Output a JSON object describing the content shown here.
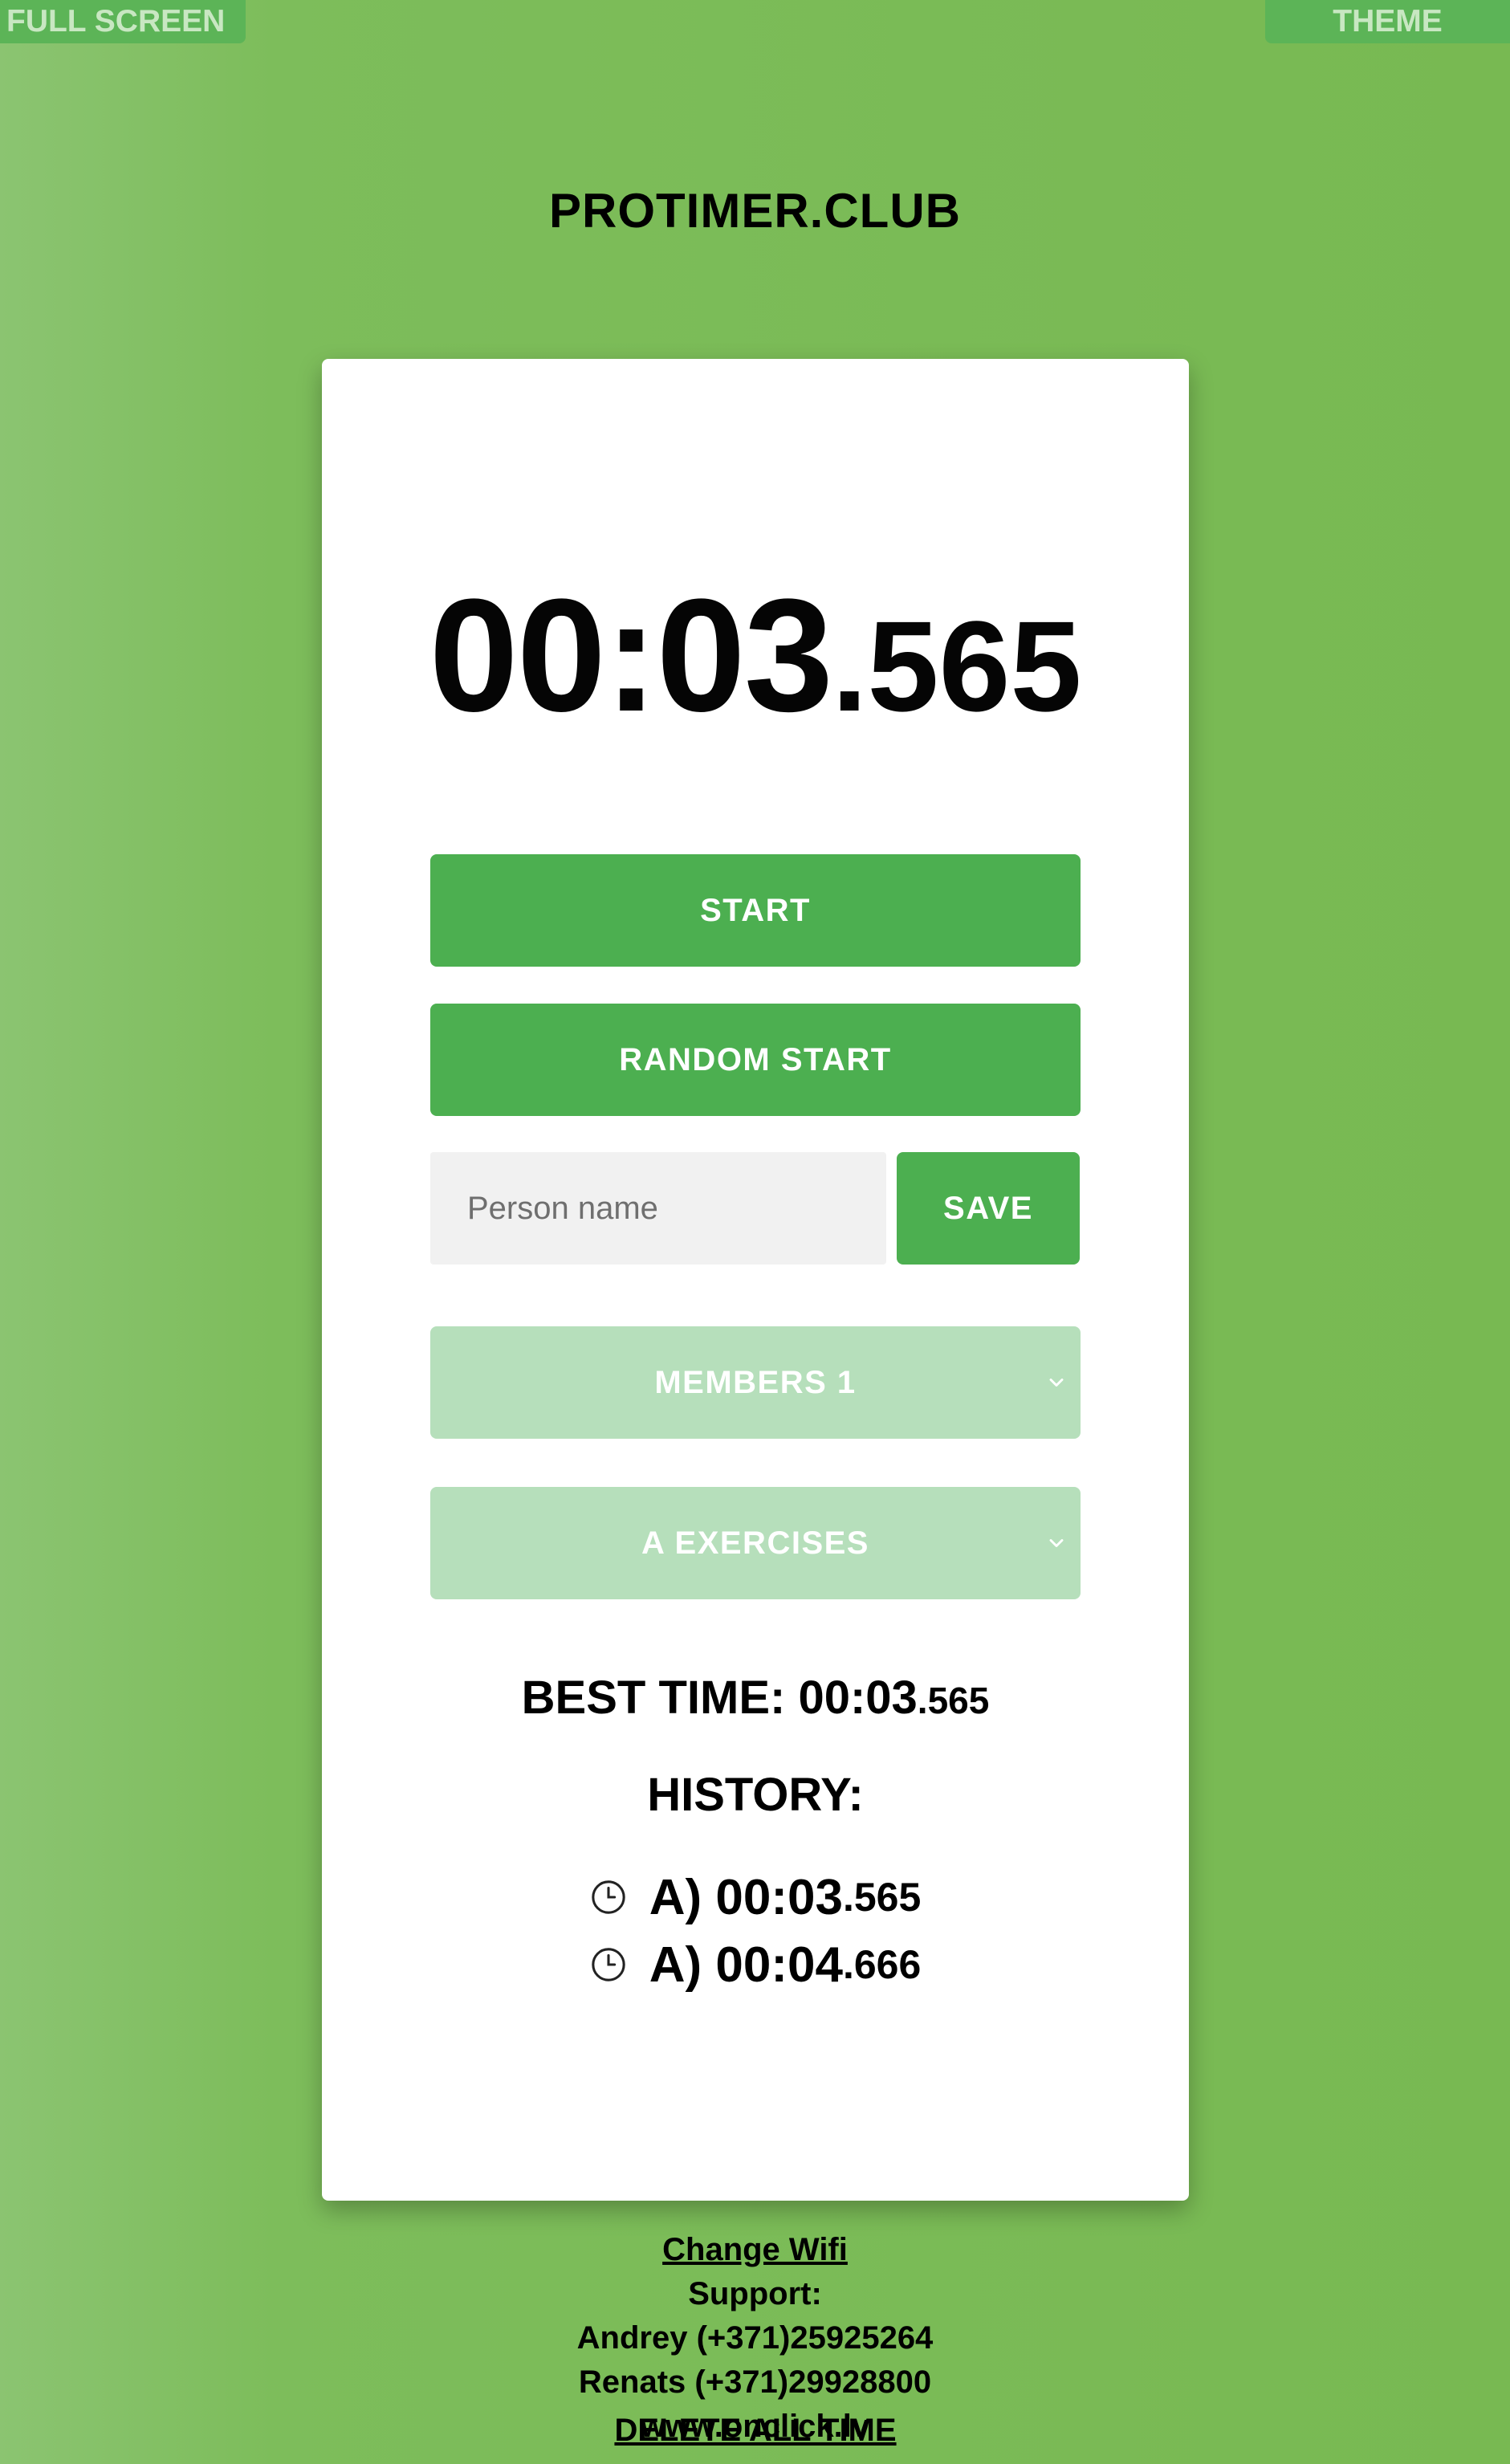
{
  "topbar": {
    "fullscreen_label": "FULL SCREEN",
    "theme_label": "THEME"
  },
  "site_title": "PROTIMER.CLUB",
  "timer": {
    "main": "00:03",
    "ms": ".565"
  },
  "buttons": {
    "start_label": "START",
    "random_start_label": "RANDOM START",
    "save_label": "SAVE"
  },
  "person_input": {
    "value": "",
    "placeholder": "Person name"
  },
  "selects": {
    "members_value": "MEMBERS 1",
    "exercises_value": "A EXERCISES"
  },
  "best_time": {
    "label": "BEST TIME: ",
    "main": "00:03",
    "ms": ".565"
  },
  "history": {
    "title": "HISTORY:",
    "items": [
      {
        "prefix": "A) ",
        "main": "00:03",
        "ms": ".565",
        "icon": "clock-icon"
      },
      {
        "prefix": "A) ",
        "main": "00:04",
        "ms": ".666",
        "icon": "clock-icon"
      }
    ]
  },
  "delete_label": "DELETE ALL TIME",
  "footer": {
    "change_wifi": "Change Wifi",
    "support": "Support:",
    "contact1": "Andrey (+371)25925264",
    "contact2": "Renats (+371)29928800",
    "website": "www.onclick.lv"
  },
  "colors": {
    "background": "#7dbd5b",
    "primary": "#4caf50",
    "select_bg": "#b6dfbb",
    "card": "#ffffff"
  }
}
